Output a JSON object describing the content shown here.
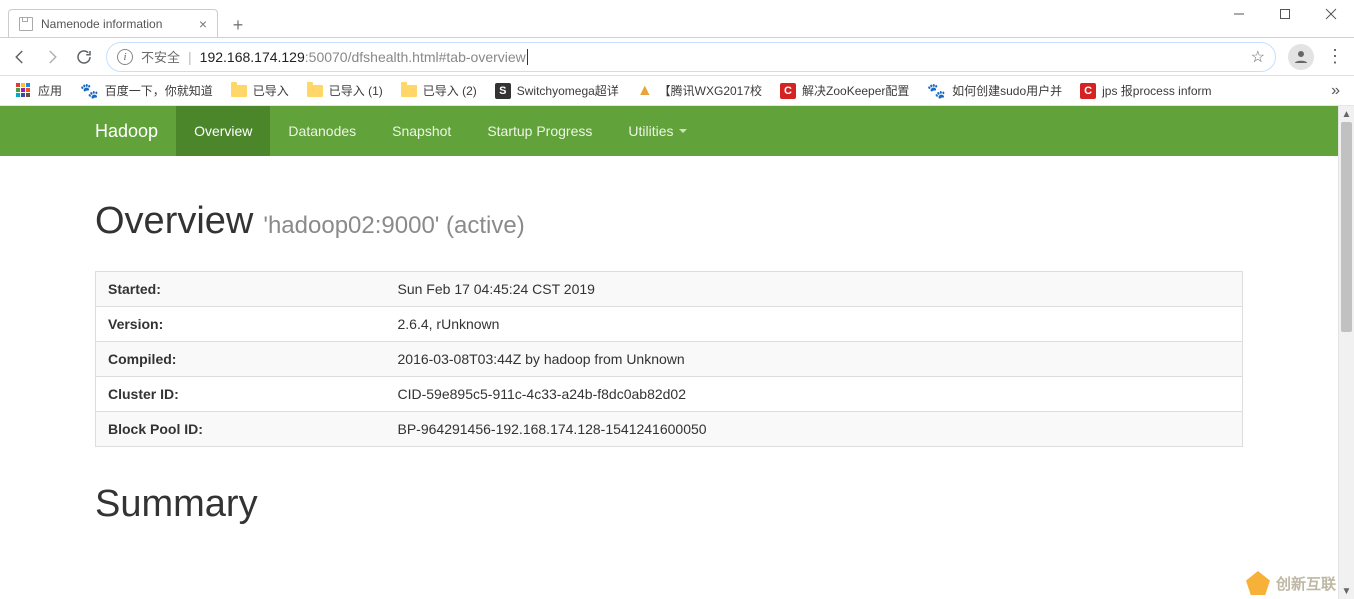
{
  "window": {
    "tab_title": "Namenode information",
    "url_prefix": "192.168.174.129",
    "url_suffix": ":50070/dfshealth.html#tab-overview",
    "unsafe_label": "不安全"
  },
  "bookmarks": {
    "apps": "应用",
    "baidu": "百度一下，你就知道",
    "imp1": "已导入",
    "imp2": "已导入 (1)",
    "imp3": "已导入 (2)",
    "switchy": "Switchyomega超详",
    "tx": "【腾讯WXG2017校",
    "zk": "解决ZooKeeper配置",
    "sudo": "如何创建sudo用户并",
    "jps": "jps 报process inform"
  },
  "nav": {
    "brand": "Hadoop",
    "overview": "Overview",
    "datanodes": "Datanodes",
    "snapshot": "Snapshot",
    "startup": "Startup Progress",
    "utilities": "Utilities"
  },
  "overview": {
    "heading": "Overview",
    "sub": "'hadoop02:9000' (active)",
    "rows": [
      {
        "k": "Started:",
        "v": "Sun Feb 17 04:45:24 CST 2019"
      },
      {
        "k": "Version:",
        "v": "2.6.4, rUnknown"
      },
      {
        "k": "Compiled:",
        "v": "2016-03-08T03:44Z by hadoop from Unknown"
      },
      {
        "k": "Cluster ID:",
        "v": "CID-59e895c5-911c-4c33-a24b-f8dc0ab82d02"
      },
      {
        "k": "Block Pool ID:",
        "v": "BP-964291456-192.168.174.128-1541241600050"
      }
    ]
  },
  "summary": {
    "heading": "Summary"
  },
  "watermark": "创新互联"
}
